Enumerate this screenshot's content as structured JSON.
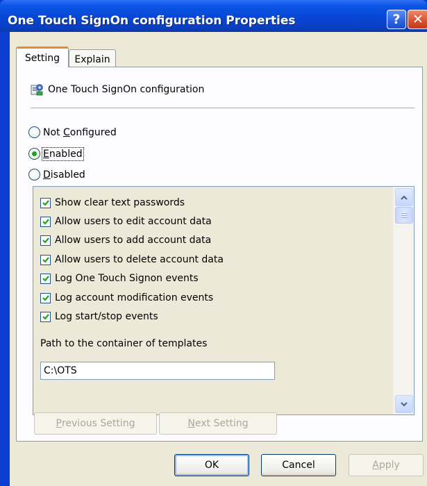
{
  "window": {
    "title": "One Touch SignOn configuration Properties",
    "help_label": "?",
    "close_label": "✕"
  },
  "tabs": [
    {
      "label": "Setting",
      "active": true
    },
    {
      "label": "Explain",
      "active": false
    }
  ],
  "policy": {
    "title": "One Touch SignOn configuration",
    "icon": "policy-settings-icon"
  },
  "radios": [
    {
      "prefix": "Not ",
      "accel": "C",
      "suffix": "onfigured",
      "selected": false
    },
    {
      "prefix": "",
      "accel": "E",
      "suffix": "nabled",
      "selected": true
    },
    {
      "prefix": "",
      "accel": "D",
      "suffix": "isabled",
      "selected": false
    }
  ],
  "options": {
    "checkboxes": [
      {
        "label": "Show clear text passwords",
        "checked": true
      },
      {
        "label": "Allow users to edit account data",
        "checked": true
      },
      {
        "label": "Allow users to add account data",
        "checked": true
      },
      {
        "label": "Allow users to delete account data",
        "checked": true
      },
      {
        "label": "Log One Touch Signon events",
        "checked": true
      },
      {
        "label": "Log account modification events",
        "checked": true
      },
      {
        "label": "Log start/stop events",
        "checked": true
      }
    ],
    "path_label": "Path to the container of templates",
    "path_value": "C:\\OTS"
  },
  "nav_buttons": {
    "prev": {
      "accel": "P",
      "rest": "revious Setting"
    },
    "next": {
      "accel": "N",
      "rest": "ext Setting"
    }
  },
  "dialog_buttons": {
    "ok": "OK",
    "cancel": "Cancel",
    "apply_accel": "A",
    "apply_rest": "pply"
  },
  "colors": {
    "titlebar": "#0846d6",
    "accent_tab": "#e68b2c",
    "check_green": "#21a121"
  }
}
